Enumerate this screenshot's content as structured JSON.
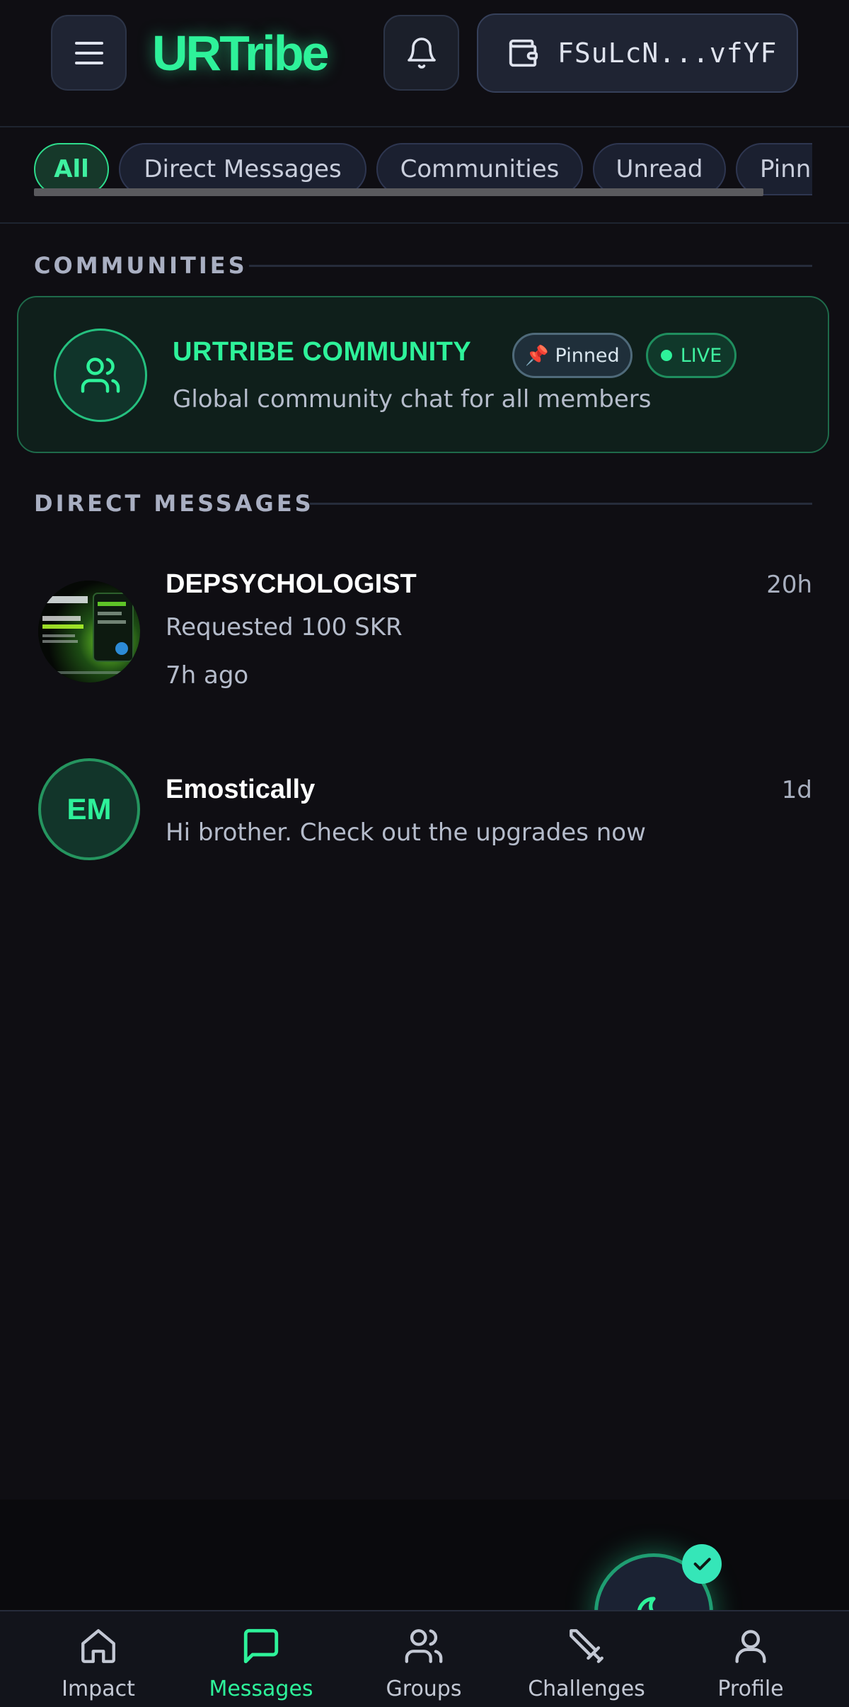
{
  "header": {
    "logo": "URTribe",
    "wallet_address": "FSuLcN...vfYF"
  },
  "filters": {
    "tabs": [
      {
        "label": "All",
        "active": true
      },
      {
        "label": "Direct Messages",
        "active": false
      },
      {
        "label": "Communities",
        "active": false
      },
      {
        "label": "Unread",
        "active": false
      },
      {
        "label": "Pinned",
        "active": false
      }
    ]
  },
  "communities": {
    "section_title": "COMMUNITIES",
    "items": [
      {
        "name": "URTRIBE COMMUNITY",
        "pinned_label": "📌 Pinned",
        "live_label": "LIVE",
        "description": "Global community chat for all members"
      }
    ]
  },
  "direct_messages": {
    "section_title": "DIRECT MESSAGES",
    "items": [
      {
        "name": "DEPSYCHOLOGIST",
        "time": "20h",
        "preview": "Requested 100 SKR",
        "sub": "7h ago"
      },
      {
        "name": "Emostically",
        "initials": "EM",
        "time": "1d",
        "preview": "Hi brother. Check out the upgrades now"
      }
    ]
  },
  "nav": {
    "items": [
      {
        "label": "Impact",
        "icon": "home-icon",
        "active": false
      },
      {
        "label": "Messages",
        "icon": "chat-icon",
        "active": true
      },
      {
        "label": "Groups",
        "icon": "users-icon",
        "active": false
      },
      {
        "label": "Challenges",
        "icon": "sword-icon",
        "active": false
      },
      {
        "label": "Profile",
        "icon": "user-icon",
        "active": false
      }
    ]
  },
  "colors": {
    "accent": "#2ef29a",
    "background": "#0f0e13",
    "card_border": "#1e6a4a"
  }
}
